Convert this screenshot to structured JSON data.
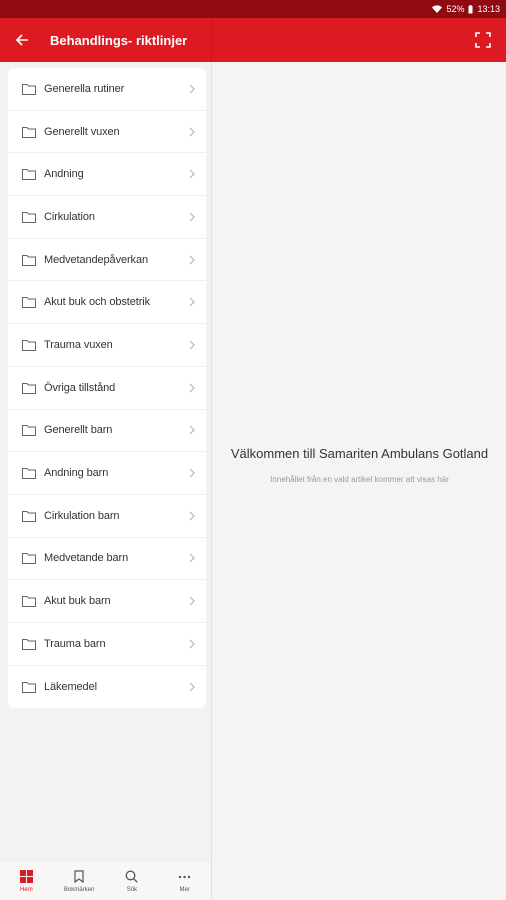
{
  "status_bar": {
    "battery": "52%",
    "time": "13:13"
  },
  "app_bar": {
    "title": "Behandlings- riktlinjer"
  },
  "menu": {
    "items": [
      {
        "label": "Generella rutiner"
      },
      {
        "label": "Generellt vuxen"
      },
      {
        "label": "Andning"
      },
      {
        "label": "Cirkulation"
      },
      {
        "label": "Medvetandepåverkan"
      },
      {
        "label": "Akut buk och obstetrik"
      },
      {
        "label": "Trauma vuxen"
      },
      {
        "label": "Övriga tillstånd"
      },
      {
        "label": "Generellt barn"
      },
      {
        "label": "Andning barn"
      },
      {
        "label": "Cirkulation barn"
      },
      {
        "label": "Medvetande barn"
      },
      {
        "label": "Akut buk barn"
      },
      {
        "label": "Trauma barn"
      },
      {
        "label": "Läkemedel"
      }
    ]
  },
  "content": {
    "welcome_title": "Välkommen till Samariten Ambulans Gotland",
    "welcome_subtitle": "Innehållet från en vald artikel kommer att visas här"
  },
  "bottom_nav": {
    "items": [
      {
        "label": "Hem",
        "icon": "grid-icon",
        "active": true
      },
      {
        "label": "Bokmärken",
        "icon": "bookmark-icon",
        "active": false
      },
      {
        "label": "Sök",
        "icon": "search-icon",
        "active": false
      },
      {
        "label": "Mer",
        "icon": "more-icon",
        "active": false
      }
    ]
  },
  "colors": {
    "primary": "#dd1a21",
    "status_bar": "#8f0a11",
    "background": "#f4f4f4"
  }
}
